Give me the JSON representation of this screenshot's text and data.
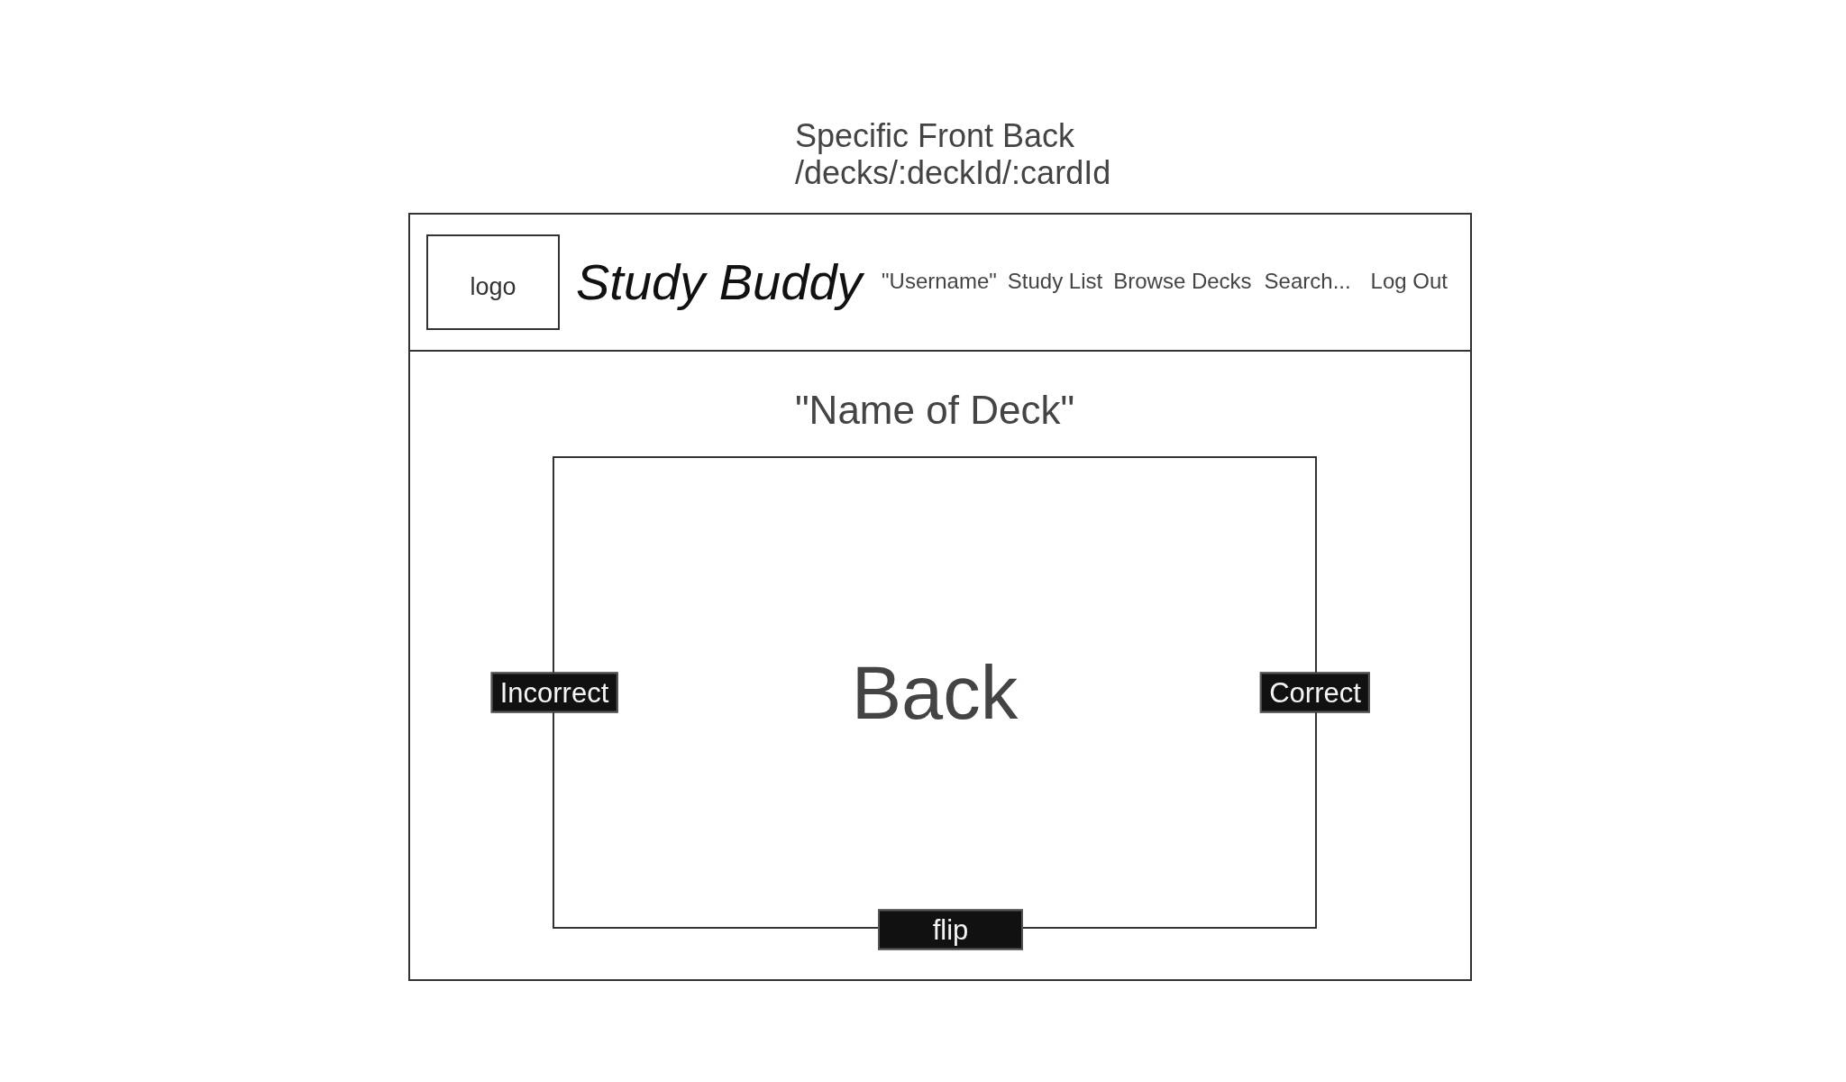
{
  "caption": {
    "title": "Specific Front Back",
    "route": "/decks/:deckId/:cardId"
  },
  "header": {
    "logo": "logo",
    "app_name": "Study Buddy",
    "nav": [
      {
        "kind": "link",
        "label": "\"Username\""
      },
      {
        "kind": "link",
        "label": "Study List"
      },
      {
        "kind": "link",
        "label": "Browse Decks"
      },
      {
        "kind": "search",
        "placeholder": "Search..."
      },
      {
        "kind": "link",
        "label": "Log Out"
      }
    ]
  },
  "deck": {
    "name": "\"Name of Deck\"",
    "card": {
      "face": "Back"
    },
    "buttons": [
      {
        "kind": "incorrect",
        "label": "Incorrect"
      },
      {
        "kind": "correct",
        "label": "Correct"
      },
      {
        "kind": "flip",
        "label": "flip"
      }
    ]
  }
}
